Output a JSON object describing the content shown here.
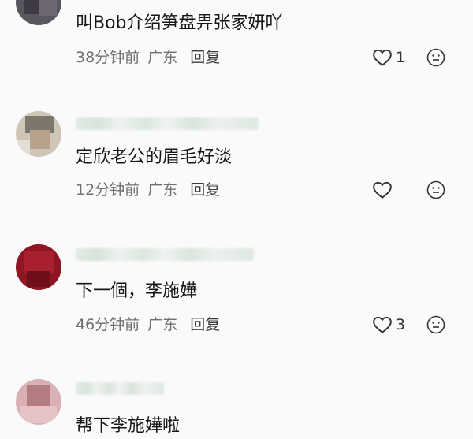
{
  "comments": [
    {
      "text": "叫Bob介绍笋盘畀张家妍吖",
      "time": "38分钟前",
      "location": "广东",
      "reply_label": "回复",
      "likes": "1"
    },
    {
      "text": "定欣老公的眉毛好淡",
      "time": "12分钟前",
      "location": "广东",
      "reply_label": "回复",
      "likes": ""
    },
    {
      "text": "下一個，李施嬅",
      "time": "46分钟前",
      "location": "广东",
      "reply_label": "回复",
      "likes": "3"
    },
    {
      "text": "帮下李施嬅啦",
      "time": "",
      "location": "",
      "reply_label": "",
      "likes": ""
    }
  ],
  "icons": {
    "like": "heart-outline-icon",
    "reaction": "neutral-face-icon"
  },
  "colors": {
    "background": "#fafafa",
    "text": "#161616",
    "meta": "#6f6f6f"
  }
}
